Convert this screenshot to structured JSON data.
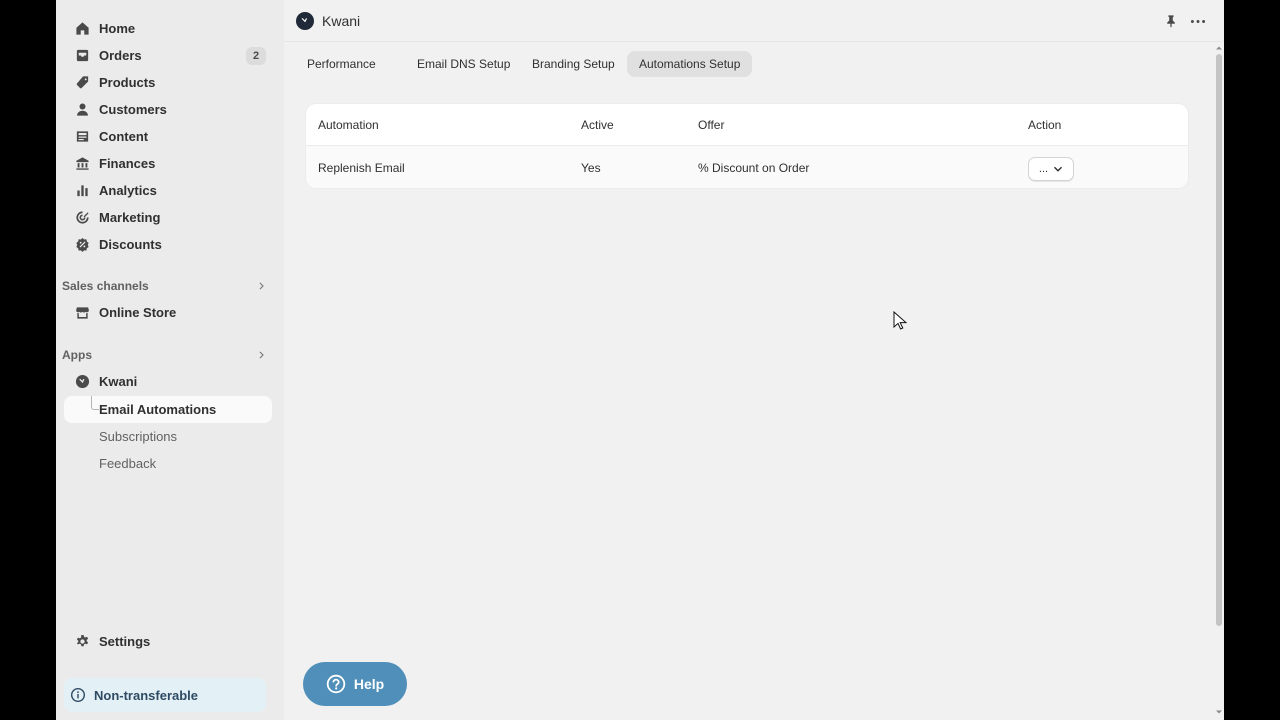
{
  "sidebar": {
    "nav": [
      {
        "label": "Home",
        "icon": "home-icon"
      },
      {
        "label": "Orders",
        "icon": "orders-icon",
        "badge": "2"
      },
      {
        "label": "Products",
        "icon": "tag-icon"
      },
      {
        "label": "Customers",
        "icon": "person-icon"
      },
      {
        "label": "Content",
        "icon": "content-icon"
      },
      {
        "label": "Finances",
        "icon": "bank-icon"
      },
      {
        "label": "Analytics",
        "icon": "bar-chart-icon"
      },
      {
        "label": "Marketing",
        "icon": "target-icon"
      },
      {
        "label": "Discounts",
        "icon": "discount-icon"
      }
    ],
    "sales_channels": {
      "heading": "Sales channels",
      "items": [
        {
          "label": "Online Store",
          "icon": "store-icon"
        }
      ]
    },
    "apps": {
      "heading": "Apps",
      "app": {
        "label": "Kwani",
        "icon": "kwani-logo-icon"
      },
      "sub_items": [
        {
          "label": "Email Automations",
          "active": true
        },
        {
          "label": "Subscriptions",
          "active": false
        },
        {
          "label": "Feedback",
          "active": false
        }
      ]
    },
    "settings": {
      "label": "Settings",
      "icon": "gear-icon"
    },
    "notice": {
      "label": "Non-transferable",
      "icon": "info-icon"
    }
  },
  "header": {
    "app_name": "Kwani",
    "icons": [
      "pin-icon",
      "more-icon"
    ]
  },
  "tabs": [
    {
      "label": "Performance",
      "selected": false
    },
    {
      "label": "Email DNS Setup",
      "selected": false
    },
    {
      "label": "Branding Setup",
      "selected": false
    },
    {
      "label": "Automations Setup",
      "selected": true
    }
  ],
  "table": {
    "columns": [
      "Automation",
      "Active",
      "Offer",
      "Action"
    ],
    "rows": [
      {
        "automation": "Replenish Email",
        "active": "Yes",
        "offer": "% Discount on Order",
        "action": "..."
      }
    ]
  },
  "help": {
    "label": "Help",
    "icon": "question-icon"
  },
  "colors": {
    "accent_help": "#4f8fb9",
    "sidebar_bg": "#ebebeb",
    "page_bg": "#f1f1f1",
    "notice_bg": "#e3f1f6"
  }
}
